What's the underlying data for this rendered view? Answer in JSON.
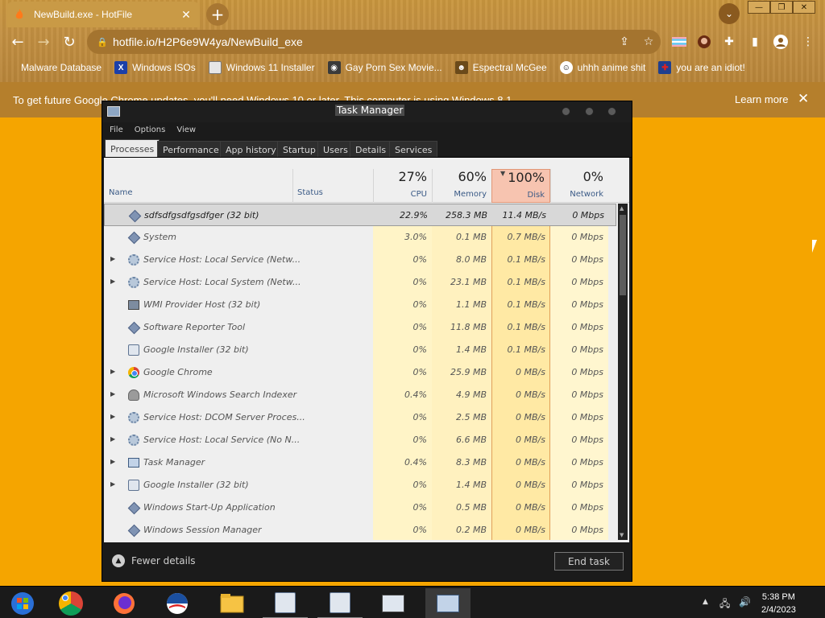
{
  "browser": {
    "tab": {
      "title": "NewBuild.exe - HotFile"
    },
    "url": "hotfile.io/H2P6e9W4ya/NewBuild_exe",
    "bookmarks": [
      {
        "label": "Malware Database"
      },
      {
        "label": "Windows ISOs"
      },
      {
        "label": "Windows 11 Installer"
      },
      {
        "label": "Gay Porn Sex Movie..."
      },
      {
        "label": "Espectral McGee"
      },
      {
        "label": "uhhh anime shit"
      },
      {
        "label": "you are an idiot!"
      }
    ],
    "infobar": {
      "message": "To get future Google Chrome updates, you'll need Windows 10 or later. This computer is using Windows 8.1.",
      "learn_more": "Learn more"
    }
  },
  "task_manager": {
    "title": "Task Manager",
    "menu": [
      "File",
      "Options",
      "View"
    ],
    "tabs": [
      "Processes",
      "Performance",
      "App history",
      "Startup",
      "Users",
      "Details",
      "Services"
    ],
    "columns": {
      "name": "Name",
      "status": "Status",
      "cpu": {
        "pct": "27%",
        "label": "CPU"
      },
      "memory": {
        "pct": "60%",
        "label": "Memory"
      },
      "disk": {
        "pct": "100%",
        "label": "Disk"
      },
      "network": {
        "pct": "0%",
        "label": "Network"
      }
    },
    "processes": [
      {
        "name": "sdfsdfgsdfgsdfger (32 bit)",
        "icon": "diamond",
        "expand": false,
        "cpu": "22.9%",
        "memory": "258.3 MB",
        "disk": "11.4 MB/s",
        "network": "0 Mbps",
        "selected": true
      },
      {
        "name": "System",
        "icon": "diamond",
        "expand": false,
        "cpu": "3.0%",
        "memory": "0.1 MB",
        "disk": "0.7 MB/s",
        "network": "0 Mbps"
      },
      {
        "name": "Service Host: Local Service (Netw...",
        "icon": "gear",
        "expand": true,
        "cpu": "0%",
        "memory": "8.0 MB",
        "disk": "0.1 MB/s",
        "network": "0 Mbps"
      },
      {
        "name": "Service Host: Local System (Netw...",
        "icon": "gear",
        "expand": true,
        "cpu": "0%",
        "memory": "23.1 MB",
        "disk": "0.1 MB/s",
        "network": "0 Mbps"
      },
      {
        "name": "WMI Provider Host (32 bit)",
        "icon": "box",
        "expand": false,
        "cpu": "0%",
        "memory": "1.1 MB",
        "disk": "0.1 MB/s",
        "network": "0 Mbps"
      },
      {
        "name": "Software Reporter Tool",
        "icon": "diamond",
        "expand": false,
        "cpu": "0%",
        "memory": "11.8 MB",
        "disk": "0.1 MB/s",
        "network": "0 Mbps"
      },
      {
        "name": "Google Installer (32 bit)",
        "icon": "installer",
        "expand": false,
        "cpu": "0%",
        "memory": "1.4 MB",
        "disk": "0.1 MB/s",
        "network": "0 Mbps"
      },
      {
        "name": "Google Chrome",
        "icon": "chrome",
        "expand": true,
        "cpu": "0%",
        "memory": "25.9 MB",
        "disk": "0 MB/s",
        "network": "0 Mbps"
      },
      {
        "name": "Microsoft Windows Search Indexer",
        "icon": "user",
        "expand": true,
        "cpu": "0.4%",
        "memory": "4.9 MB",
        "disk": "0 MB/s",
        "network": "0 Mbps"
      },
      {
        "name": "Service Host: DCOM Server Proces...",
        "icon": "gear",
        "expand": true,
        "cpu": "0%",
        "memory": "2.5 MB",
        "disk": "0 MB/s",
        "network": "0 Mbps"
      },
      {
        "name": "Service Host: Local Service (No N...",
        "icon": "gear",
        "expand": true,
        "cpu": "0%",
        "memory": "6.6 MB",
        "disk": "0 MB/s",
        "network": "0 Mbps"
      },
      {
        "name": "Task Manager",
        "icon": "taskmgr",
        "expand": true,
        "cpu": "0.4%",
        "memory": "8.3 MB",
        "disk": "0 MB/s",
        "network": "0 Mbps"
      },
      {
        "name": "Google Installer (32 bit)",
        "icon": "installer",
        "expand": true,
        "cpu": "0%",
        "memory": "1.4 MB",
        "disk": "0 MB/s",
        "network": "0 Mbps"
      },
      {
        "name": "Windows Start-Up Application",
        "icon": "diamond",
        "expand": false,
        "cpu": "0%",
        "memory": "0.5 MB",
        "disk": "0 MB/s",
        "network": "0 Mbps"
      },
      {
        "name": "Windows Session Manager",
        "icon": "diamond",
        "expand": false,
        "cpu": "0%",
        "memory": "0.2 MB",
        "disk": "0 MB/s",
        "network": "0 Mbps"
      }
    ],
    "fewer_details": "Fewer details",
    "end_task": "End task"
  },
  "taskbar": {
    "time": "5:38 PM",
    "date": "2/4/2023"
  }
}
